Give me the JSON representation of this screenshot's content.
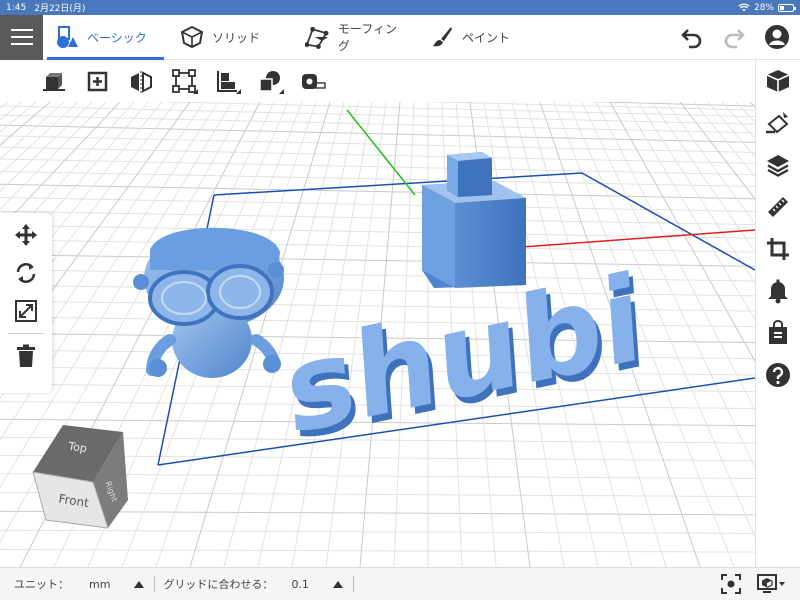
{
  "status": {
    "time": "1:45",
    "date": "2月22日(月)",
    "battery": "28%"
  },
  "tabs": [
    {
      "label": "ベーシック",
      "icon": "shapes-icon",
      "active": true
    },
    {
      "label": "ソリッド",
      "icon": "polyhedron-icon",
      "active": false
    },
    {
      "label": "モーフィング",
      "icon": "morph-icon",
      "active": false
    },
    {
      "label": "ペイント",
      "icon": "paintbrush-icon",
      "active": false
    }
  ],
  "scene_text": "shubi",
  "view_cube": {
    "top": "Top",
    "front": "Front",
    "right": "Right"
  },
  "bottom": {
    "unit_label": "ユニット：",
    "unit_value": "mm",
    "grid_label": "グリッドに合わせる：",
    "grid_value": "0.1"
  },
  "colors": {
    "accent": "#2e6fd6",
    "status_bar": "#4a78bd",
    "model": "#7aa7e0",
    "axis_x": "#e02020",
    "axis_y": "#20c020",
    "boundary": "#1a4fb0"
  }
}
